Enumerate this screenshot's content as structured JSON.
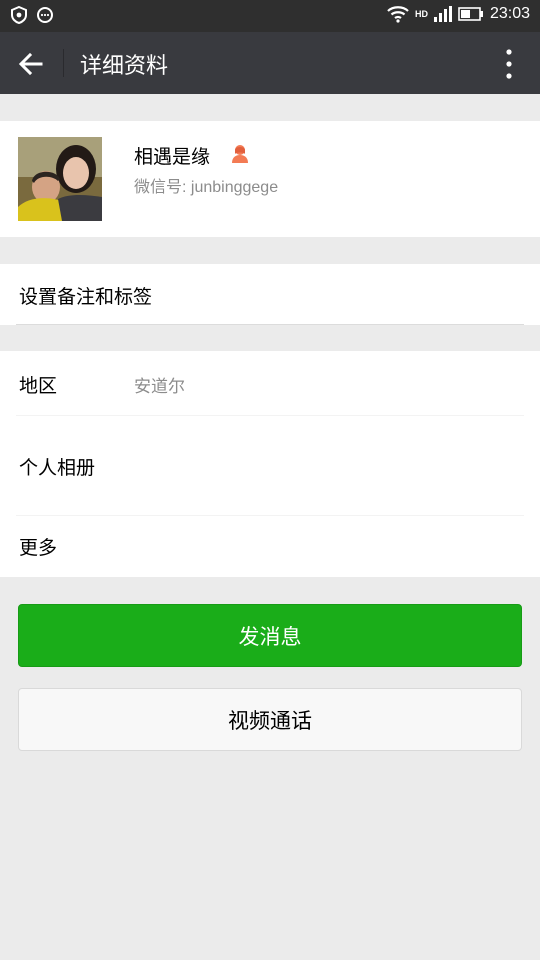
{
  "status_bar": {
    "time": "23:03",
    "network_label": "HD",
    "icons": [
      "shield-icon",
      "message-bubble-icon",
      "wifi-icon",
      "signal-icon",
      "battery-icon"
    ]
  },
  "header": {
    "title": "详细资料",
    "back_icon": "arrow-left-icon",
    "more_icon": "more-vertical-icon",
    "bar_color": "#393a3f"
  },
  "profile": {
    "name": "相遇是缘",
    "wechat_id_text": "微信号: junbinggege",
    "gender_icon": "female-icon",
    "gender_color": "#f37b54"
  },
  "remark": {
    "label": "设置备注和标签"
  },
  "info_rows": [
    {
      "label": "地区",
      "value": "安道尔"
    },
    {
      "label": "个人相册",
      "value": ""
    },
    {
      "label": "更多",
      "value": ""
    }
  ],
  "actions": {
    "send_message": "发消息",
    "video_call": "视频通话",
    "primary_color": "#1aad19"
  }
}
